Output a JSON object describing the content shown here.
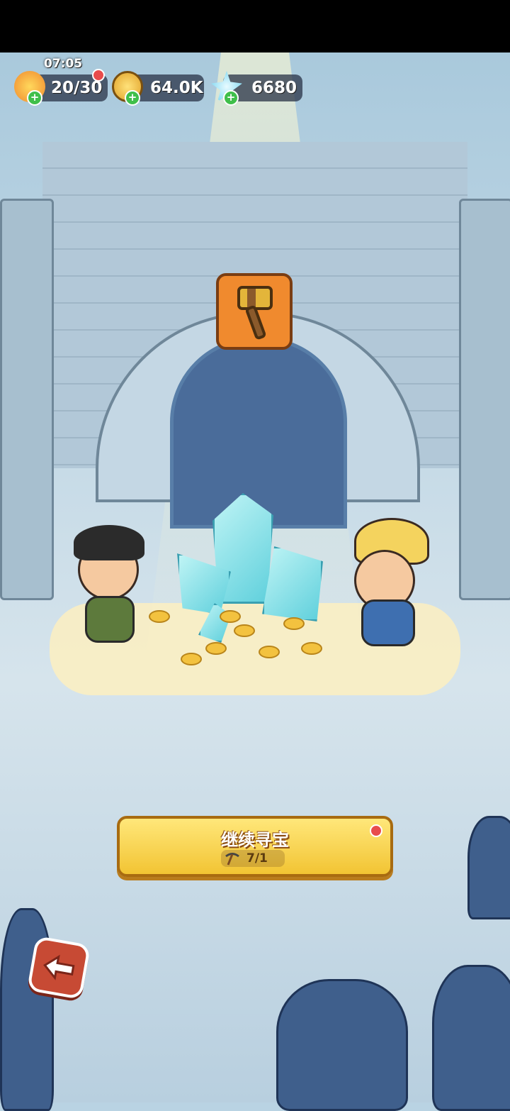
{
  "hud": {
    "time": "07:05",
    "energy": "20/30",
    "gold": "64.0K",
    "gems": "6680"
  },
  "tool_icon": "hammer-icon",
  "action_button": {
    "label": "继续寻宝",
    "counter": "7/1",
    "counter_icon": "pickaxe-icon"
  },
  "back_icon": "back-arrow-icon",
  "colors": {
    "button_yellow": "#f2c433",
    "back_red": "#c74a34",
    "badge_orange": "#f08a2e"
  }
}
